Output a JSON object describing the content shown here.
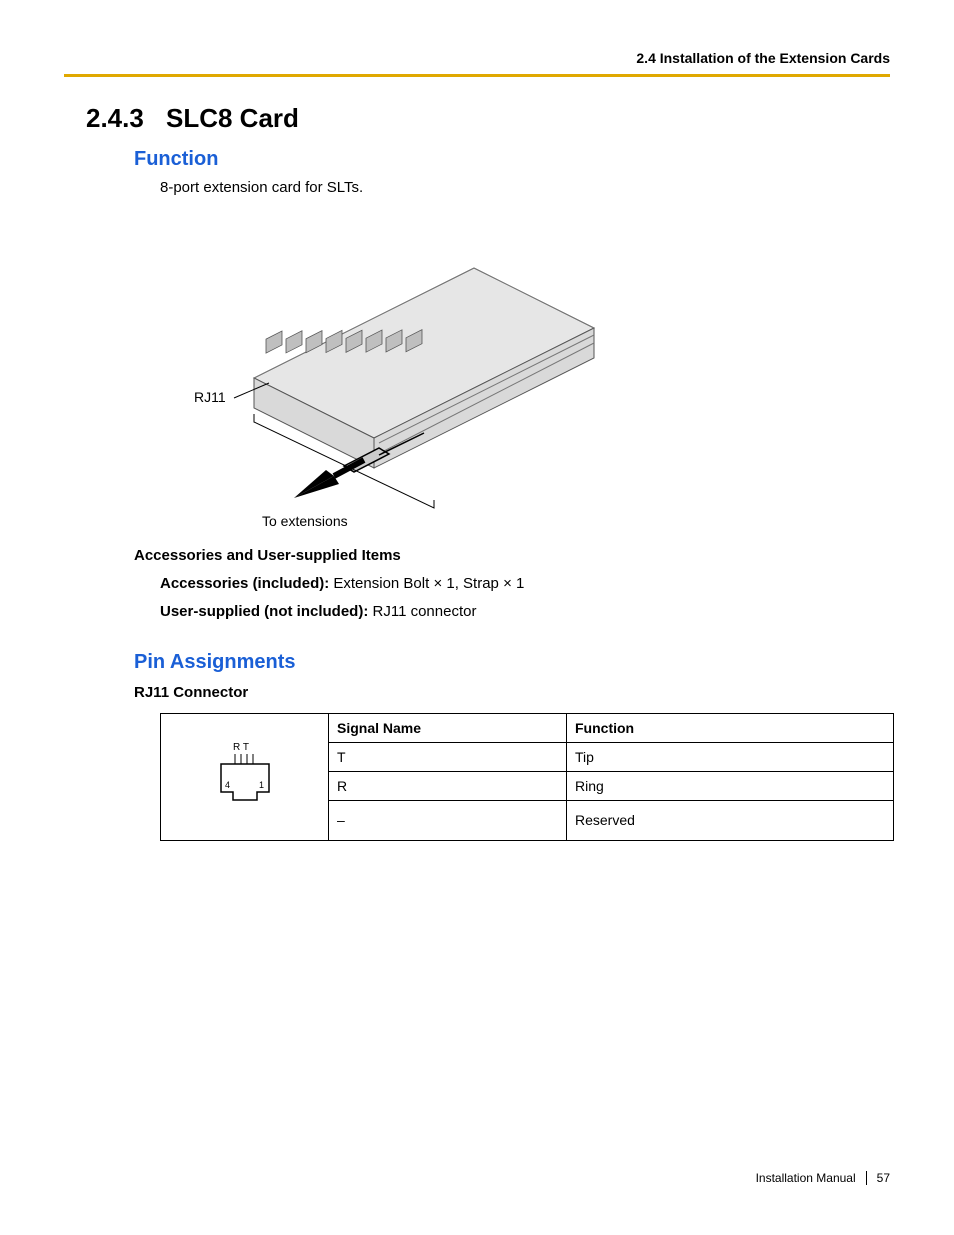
{
  "header": {
    "section_path": "2.4 Installation of the Extension Cards"
  },
  "title": {
    "number": "2.4.3",
    "name": "SLC8 Card"
  },
  "function": {
    "heading": "Function",
    "body": "8-port extension card for SLTs.",
    "diagram": {
      "label_rj11": "RJ11",
      "label_to_ext": "To extensions"
    }
  },
  "accessories": {
    "heading": "Accessories and User-supplied Items",
    "included_label": "Accessories (included):",
    "included_body": " Extension Bolt × 1, Strap × 1",
    "user_label": "User-supplied (not included):",
    "user_body": " RJ11 connector"
  },
  "pin": {
    "heading": "Pin Assignments",
    "subheading": "RJ11 Connector",
    "connector_labels": {
      "rt": "R T",
      "pin4": "4",
      "pin1": "1"
    },
    "columns": {
      "signal": "Signal Name",
      "function": "Function"
    },
    "rows": [
      {
        "signal": "T",
        "function": "Tip"
      },
      {
        "signal": "R",
        "function": "Ring"
      },
      {
        "signal": "–",
        "function": "Reserved"
      }
    ]
  },
  "footer": {
    "manual": "Installation Manual",
    "page": "57"
  }
}
